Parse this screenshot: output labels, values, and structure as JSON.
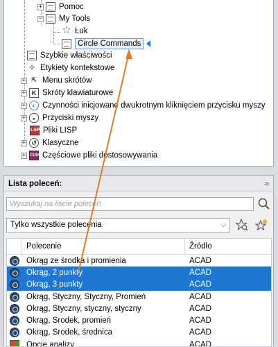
{
  "tree": {
    "items": [
      {
        "label": "Pomoc",
        "icon": "document-icon",
        "expander": "+"
      },
      {
        "label": "My Tools",
        "icon": "document-icon",
        "expander": "−"
      },
      {
        "label": "Łuk",
        "icon": "star-icon",
        "expander": ""
      },
      {
        "label": "Circle Commands",
        "icon": "document-icon",
        "expander": ""
      },
      {
        "label": "Szybkie właściwości",
        "icon": "quick-properties-icon",
        "expander": ""
      },
      {
        "label": "Etykiety kontekstowe",
        "icon": "rollover-tooltip-icon",
        "expander": ""
      },
      {
        "label": "Menu skrótów",
        "icon": "shortcut-menu-icon",
        "expander": "+"
      },
      {
        "label": "Skróty klawiaturowe",
        "icon": "keyboard-shortcut-icon",
        "expander": "+"
      },
      {
        "label": "Czynności inicjowane dwukrotnym kliknięciem przycisku myszy",
        "icon": "double-click-icon",
        "expander": "+"
      },
      {
        "label": "Przyciski myszy",
        "icon": "mouse-buttons-icon",
        "expander": "+"
      },
      {
        "label": "Pliki LISP",
        "icon": "lisp-icon",
        "expander": ""
      },
      {
        "label": "Klasyczne",
        "icon": "classic-icon",
        "expander": "+"
      },
      {
        "label": "Częściowe pliki dostosowywania",
        "icon": "cuix-icon",
        "expander": "+"
      }
    ],
    "lisp_badge": "LSP",
    "cuix_badge": "CUIX"
  },
  "command_list": {
    "title": "Lista poleceń:",
    "collapse_symbol": "≈",
    "search_placeholder": "Wyszukaj na liście poleceń",
    "filter_value": "Tylko wszystkie polecenia",
    "columns": {
      "command": "Polecenie",
      "source": "Źródło"
    },
    "rows": [
      {
        "command": "Okrąg ze środka i promienia",
        "source": "ACAD",
        "selected": false,
        "icon": "circle-icon"
      },
      {
        "command": "Okrąg, 2 punkty",
        "source": "ACAD",
        "selected": true,
        "icon": "circle-icon"
      },
      {
        "command": "Okrąg, 3 punkty",
        "source": "ACAD",
        "selected": true,
        "icon": "circle-icon"
      },
      {
        "command": "Okrąg, Styczny, Styczny, Promień",
        "source": "ACAD",
        "selected": false,
        "icon": "circle-icon"
      },
      {
        "command": "Okrąg, Styczny, styczny, styczny",
        "source": "ACAD",
        "selected": false,
        "icon": "circle-icon"
      },
      {
        "command": "Okrąg, Środek, promień",
        "source": "ACAD",
        "selected": false,
        "icon": "circle-icon"
      },
      {
        "command": "Okrąg, Środek, średnica",
        "source": "ACAD",
        "selected": false,
        "icon": "circle-icon"
      },
      {
        "command": "Opcje analizy",
        "source": "ACAD",
        "selected": false,
        "icon": "analysis-options-icon"
      }
    ]
  },
  "colors": {
    "selection": "#1e78d2",
    "drag_arrow": "#e07b28",
    "drop_marker": "#1f7fd6"
  }
}
